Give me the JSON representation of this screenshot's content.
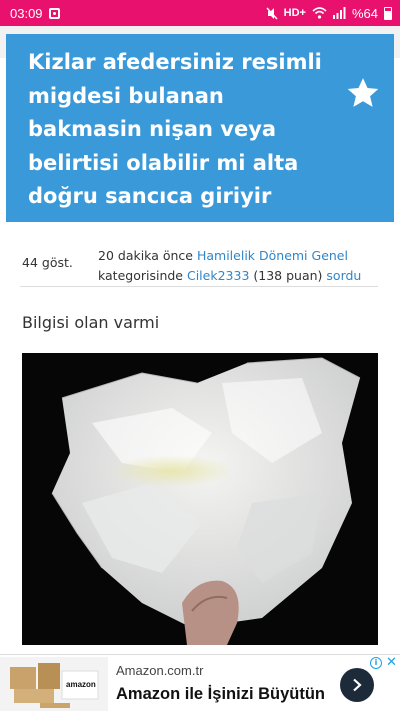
{
  "status_bar": {
    "time": "03:09",
    "network": "HD+",
    "battery": "%64"
  },
  "question": {
    "title": "Kizlar afedersiniz resimli migdesi bulanan bakmasin nişan veya belirtisi olabilir mi alta doğru sancıca giriyir",
    "views": "44 göst.",
    "time_ago": "20 dakika önce",
    "category": "Hamilelik Dönemi Genel",
    "category_suffix": "kategorisinde",
    "author": "Cilek2333",
    "points": "(138 puan)",
    "action": "sordu",
    "body": "Bilgisi olan varmi"
  },
  "ad": {
    "source": "Amazon.com.tr",
    "headline": "Amazon ile İşinizi Büyütün",
    "thumb_logo": "amazon"
  },
  "colors": {
    "status_bar": "#e8126e",
    "title_bg": "#3a9ad9",
    "link": "#2f86c9"
  }
}
